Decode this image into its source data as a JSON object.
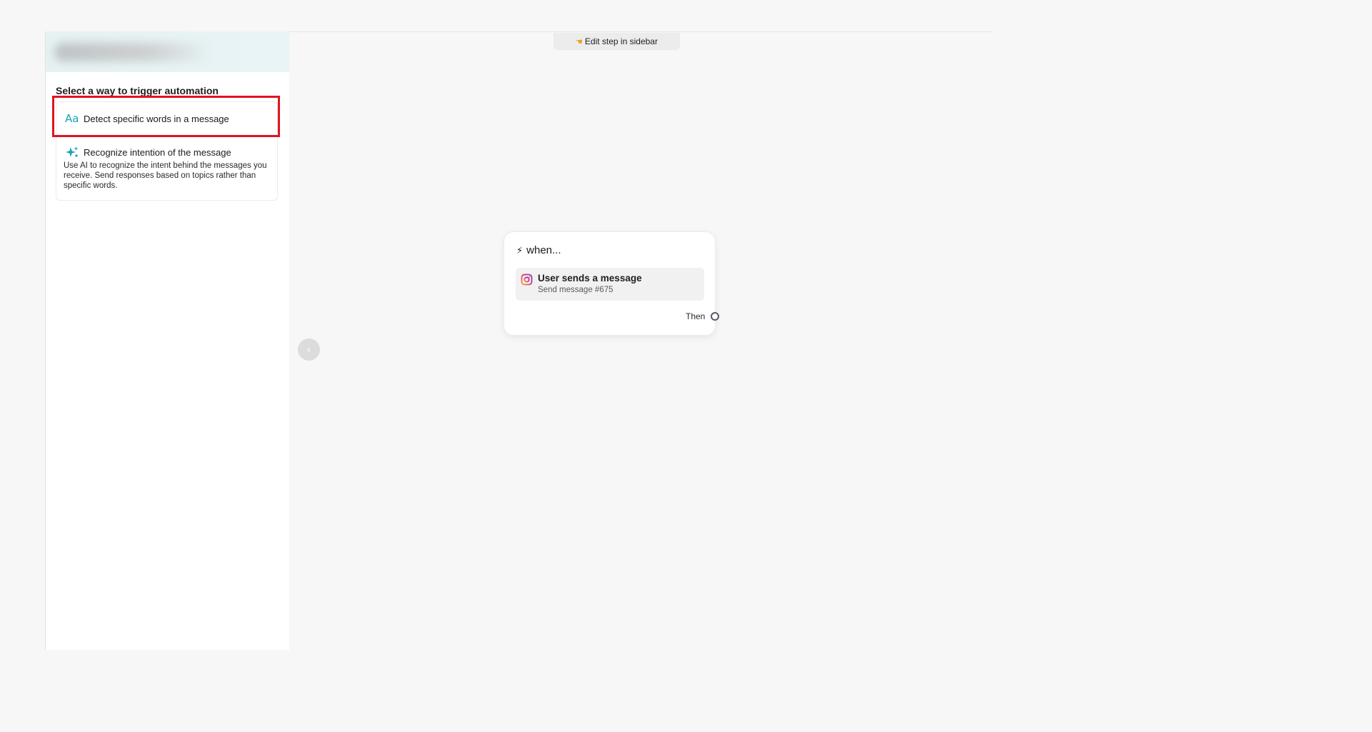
{
  "canvas": {
    "edit_tab_label": "Edit step in sidebar",
    "collapse_icon": "chevron-left-icon"
  },
  "sidebar": {
    "heading": "Select a way to trigger automation",
    "options": [
      {
        "icon": "text-aa-icon",
        "icon_glyph": "Aa",
        "label": "Detect specific words in a message"
      },
      {
        "icon": "sparkles-icon",
        "label": "Recognize intention of the message",
        "description": "Use AI to recognize the intent behind the messages you receive. Send responses based on topics rather than specific words."
      }
    ]
  },
  "node": {
    "heading": "when...",
    "trigger_title": "User sends a message",
    "trigger_subtitle": "Send message #675",
    "then_label": "Then"
  },
  "colors": {
    "highlight": "#e0141f",
    "accent": "#16a3b3"
  }
}
